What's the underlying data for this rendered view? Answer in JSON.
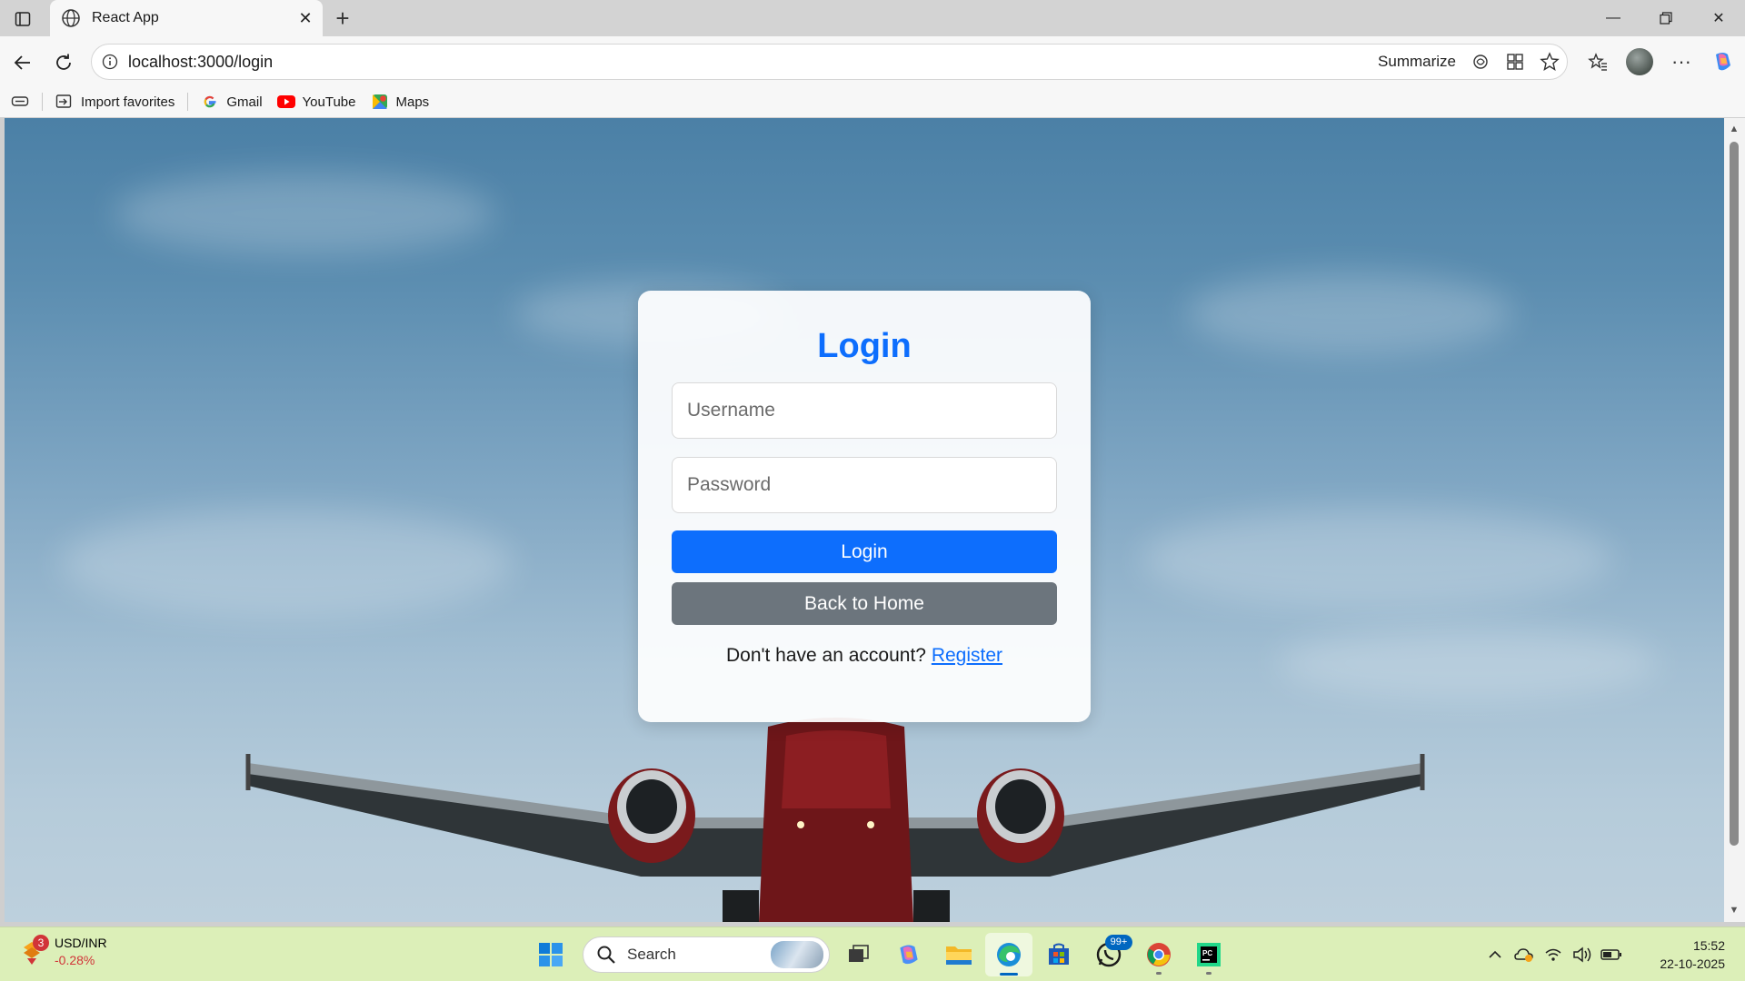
{
  "browser": {
    "tab_title": "React App",
    "url": "localhost:3000/login",
    "summarize_label": "Summarize",
    "bookmarks": [
      {
        "label": "Import favorites",
        "icon": "import-favorites-icon"
      },
      {
        "label": "Gmail",
        "icon": "gmail-icon"
      },
      {
        "label": "YouTube",
        "icon": "youtube-icon"
      },
      {
        "label": "Maps",
        "icon": "maps-icon"
      }
    ]
  },
  "login": {
    "title": "Login",
    "username_placeholder": "Username",
    "password_placeholder": "Password",
    "login_button": "Login",
    "back_button": "Back to Home",
    "signup_prompt": "Don't have an account?",
    "register_link": "Register"
  },
  "taskbar": {
    "widget_badge": "3",
    "widget_title": "USD/INR",
    "widget_change": "-0.28%",
    "search_label": "Search",
    "whatsapp_badge": "99+",
    "time": "15:52",
    "date": "22-10-2025"
  },
  "colors": {
    "primary": "#0d6efd",
    "secondary": "#6c757d",
    "taskbar_bg": "#dcefb8"
  }
}
